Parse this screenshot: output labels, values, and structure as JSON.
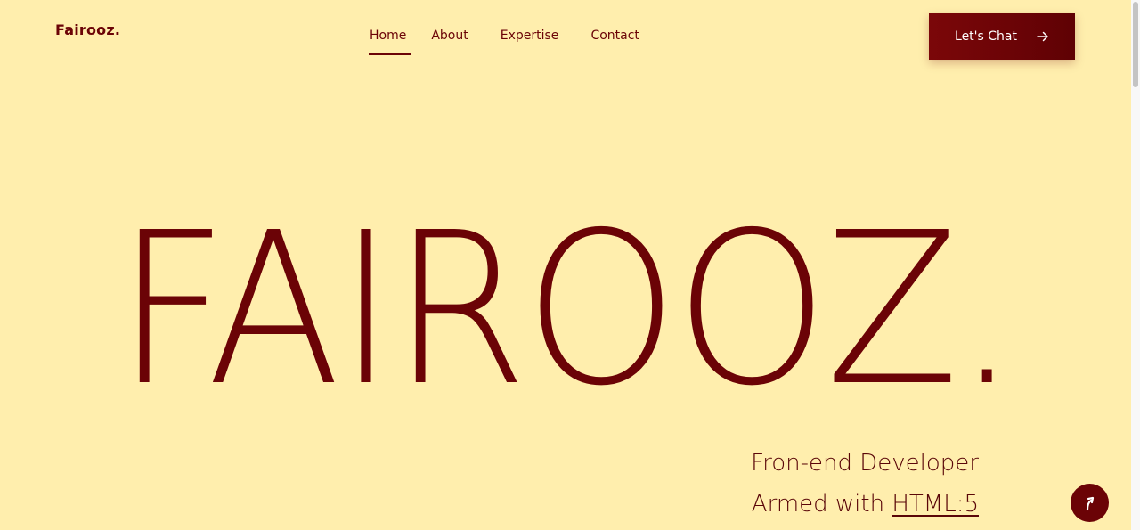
{
  "header": {
    "logo": "Fairooz.",
    "nav": [
      {
        "label": "Home",
        "active": true
      },
      {
        "label": "About",
        "active": false
      },
      {
        "label": "Expertise",
        "active": false
      },
      {
        "label": "Contact",
        "active": false
      }
    ],
    "cta_label": "Let's Chat",
    "cta_icon": "arrow-right-icon"
  },
  "hero": {
    "title": "FAIROOZ.",
    "role": "Fron-end Developer",
    "armed_prefix": "Armed with ",
    "armed_skill": "HTML:5"
  },
  "scroll_top_icon": "arrow-up-icon",
  "colors": {
    "background": "#FFEEAD",
    "accent": "#6B0306",
    "button_text": "#FFFFFF"
  }
}
